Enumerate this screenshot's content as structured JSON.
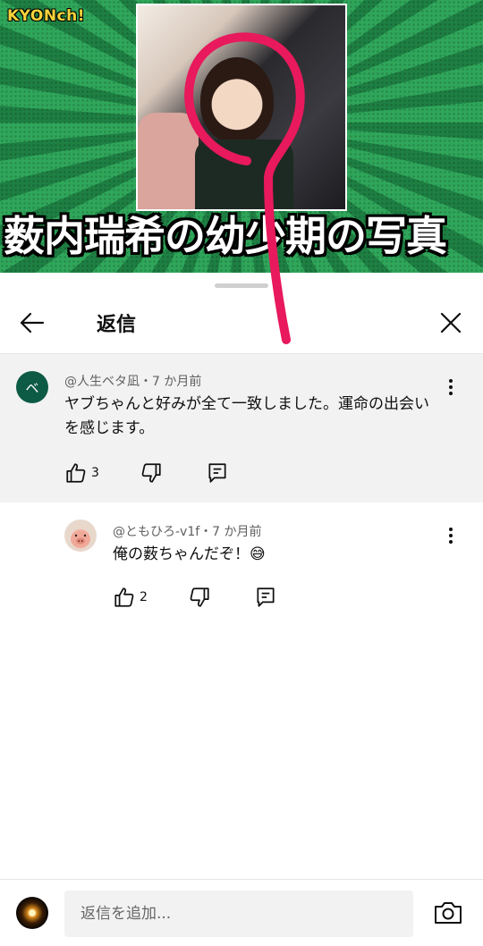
{
  "video": {
    "brand": "KYONch!",
    "overlay_title": "薮内瑞希の幼少期の写真"
  },
  "sheet": {
    "title": "返信"
  },
  "comments": [
    {
      "avatar_letter": "ベ",
      "meta": "@人生ベタ凪・7 か月前",
      "text": "ヤブちゃんと好みが全て一致しました。運命の出会いを感じます。",
      "likes": "3"
    },
    {
      "meta": "@ともひろ-v1f・7 か月前",
      "text": "俺の薮ちゃんだぞ！😅",
      "likes": "2"
    }
  ],
  "reply_bar": {
    "placeholder": "返信を追加..."
  },
  "icons": {
    "back": "arrow-left-icon",
    "close": "close-icon",
    "more": "more-vert-icon",
    "like": "thumb-up-icon",
    "dislike": "thumb-down-icon",
    "reply": "comment-icon",
    "camera": "camera-icon"
  },
  "colors": {
    "avatar_green": "#0d5a45",
    "scribble_pink": "#e8195c",
    "highlight_bg": "#f2f2f2"
  }
}
